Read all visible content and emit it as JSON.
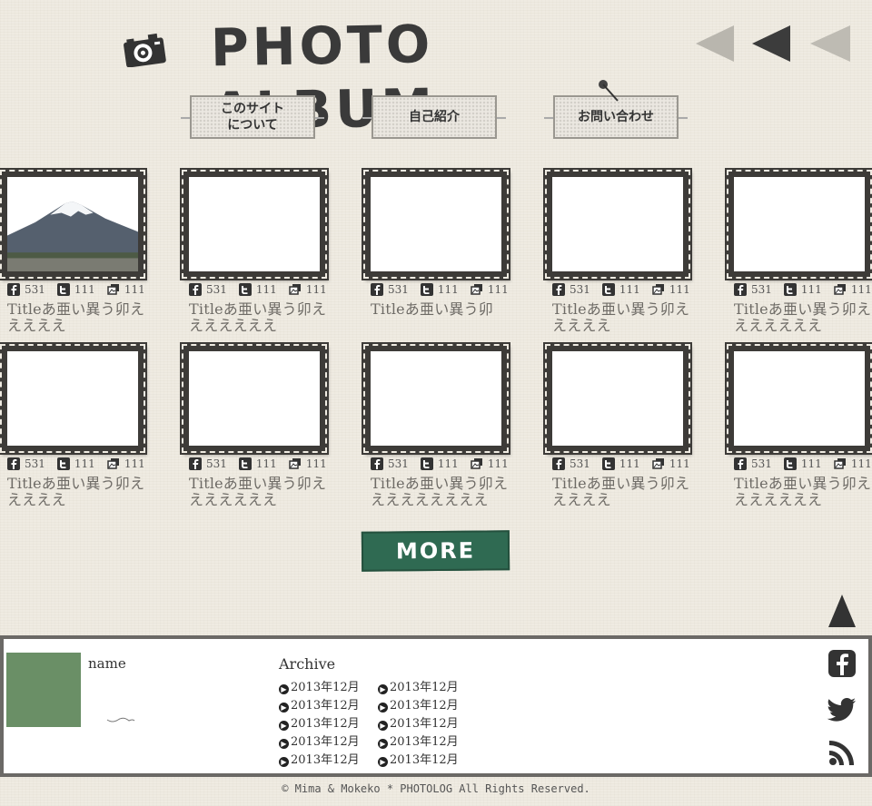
{
  "header": {
    "title": "PHOTO ALBUM"
  },
  "nav": [
    {
      "label": "このサイト\nについて"
    },
    {
      "label": "自己紹介"
    },
    {
      "label": "お問い合わせ"
    }
  ],
  "cards": [
    {
      "fb": "531",
      "tw": "111",
      "ph": "111",
      "caption": "Titleあ亜い異う卯えええええ"
    },
    {
      "fb": "531",
      "tw": "111",
      "ph": "111",
      "caption": "Titleあ亜い異う卯えええええええ"
    },
    {
      "fb": "531",
      "tw": "111",
      "ph": "111",
      "caption": "Titleあ亜い異う卯"
    },
    {
      "fb": "531",
      "tw": "111",
      "ph": "111",
      "caption": "Titleあ亜い異う卯えええええ"
    },
    {
      "fb": "531",
      "tw": "111",
      "ph": "111",
      "caption": "Titleあ亜い異う卯えええええええ"
    },
    {
      "fb": "531",
      "tw": "111",
      "ph": "111",
      "caption": "Titleあ亜い異う卯えええええ"
    },
    {
      "fb": "531",
      "tw": "111",
      "ph": "111",
      "caption": "Titleあ亜い異う卯えええええええ"
    },
    {
      "fb": "531",
      "tw": "111",
      "ph": "111",
      "caption": "Titleあ亜い異う卯えええええええええ"
    },
    {
      "fb": "531",
      "tw": "111",
      "ph": "111",
      "caption": "Titleあ亜い異う卯えええええ"
    },
    {
      "fb": "531",
      "tw": "111",
      "ph": "111",
      "caption": "Titleあ亜い異う卯えええええええ"
    }
  ],
  "more_label": "MORE",
  "footer": {
    "name": "name",
    "archive_title": "Archive",
    "archive": [
      "2013年12月",
      "2013年12月",
      "2013年12月",
      "2013年12月",
      "2013年12月",
      "2013年12月",
      "2013年12月",
      "2013年12月",
      "2013年12月",
      "2013年12月"
    ]
  },
  "copyright": "© Mima & Mokeko * PHOTOLOG All Rights Reserved.",
  "colors": {
    "accent_green": "#2f6a52",
    "frame": "#3d3b38",
    "avatar": "#6a8f66"
  }
}
